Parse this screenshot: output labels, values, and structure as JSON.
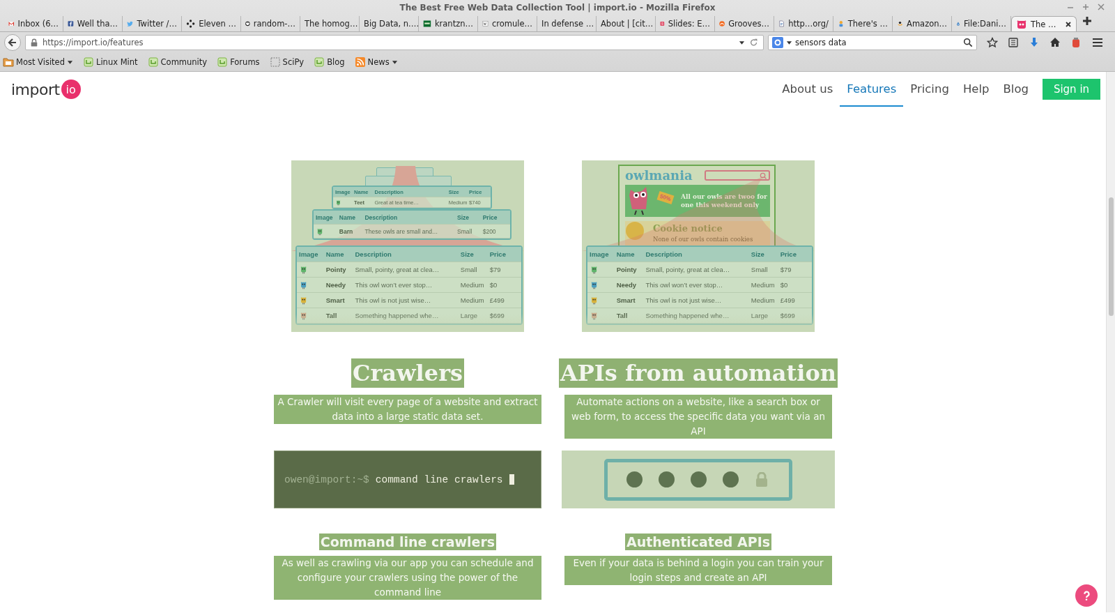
{
  "window": {
    "title": "The Best Free Web Data Collection Tool | import.io - Mozilla Firefox"
  },
  "tabs": [
    {
      "label": "Inbox (6…",
      "selected": false
    },
    {
      "label": "Well tha…",
      "selected": false
    },
    {
      "label": "Twitter /…",
      "selected": false
    },
    {
      "label": "Eleven …",
      "selected": false
    },
    {
      "label": "random-…",
      "selected": false
    },
    {
      "label": "The homog…",
      "selected": false
    },
    {
      "label": "Big Data, n.…",
      "selected": false
    },
    {
      "label": "krantzn…",
      "selected": false
    },
    {
      "label": "cromule…",
      "selected": false
    },
    {
      "label": "In defense …",
      "selected": false
    },
    {
      "label": "About | [cit…",
      "selected": false
    },
    {
      "label": "Slides: E…",
      "selected": false
    },
    {
      "label": "Grooves…",
      "selected": false
    },
    {
      "label": "http…org/",
      "selected": false
    },
    {
      "label": "There's …",
      "selected": false
    },
    {
      "label": "Amazon…",
      "selected": false
    },
    {
      "label": "File:Dani…",
      "selected": false
    },
    {
      "label": "The …",
      "selected": true
    }
  ],
  "toolbar": {
    "url": "https://import.io/features",
    "search": {
      "value": "sensors data"
    }
  },
  "bookmarks": [
    {
      "label": "Most Visited",
      "kind": "folder",
      "dropdown": true
    },
    {
      "label": "Linux Mint",
      "kind": "page",
      "dropdown": false
    },
    {
      "label": "Community",
      "kind": "page",
      "dropdown": false
    },
    {
      "label": "Forums",
      "kind": "page",
      "dropdown": false
    },
    {
      "label": "SciPy",
      "kind": "blank",
      "dropdown": false
    },
    {
      "label": "Blog",
      "kind": "page",
      "dropdown": false
    },
    {
      "label": "News",
      "kind": "feed",
      "dropdown": true
    }
  ],
  "site": {
    "logo": {
      "text": "import",
      "badge": "io"
    },
    "nav": [
      {
        "label": "About us",
        "selected": false
      },
      {
        "label": "Features",
        "selected": true
      },
      {
        "label": "Pricing",
        "selected": false
      },
      {
        "label": "Help",
        "selected": false
      },
      {
        "label": "Blog",
        "selected": false
      }
    ],
    "sign_in": "Sign in"
  },
  "features": [
    {
      "title": "Crawlers",
      "description": "A Crawler will visit every page of a website and extract data into a large static data set.",
      "illustration": {
        "kind": "stacked_tables",
        "back_table": {
          "columns": [
            "Image",
            "Name",
            "Description",
            "Size",
            "Price"
          ],
          "rows": [
            [
              "",
              "Teet",
              "Great at tea time…",
              "Medium",
              "$740"
            ]
          ]
        },
        "middle_table": {
          "columns": [
            "Image",
            "Name",
            "Description",
            "Size",
            "Price"
          ],
          "rows": [
            [
              "",
              "Barn",
              "These owls are small and…",
              "Small",
              "$200"
            ]
          ]
        },
        "table": {
          "columns": [
            "Image",
            "Name",
            "Description",
            "Size",
            "Price"
          ],
          "rows": [
            [
              "",
              "Pointy",
              "Small, pointy, great at clea…",
              "Small",
              "$79"
            ],
            [
              "",
              "Needy",
              "This owl won’t ever stop…",
              "Medium",
              "$0"
            ],
            [
              "",
              "Smart",
              "This owl is not just wise…",
              "Medium",
              "£499"
            ],
            [
              "",
              "Tall",
              "Something happened whe…",
              "Large",
              "$699"
            ]
          ]
        }
      }
    },
    {
      "title": "APIs from automation",
      "description": "Automate actions on a website, like a search box or web form, to access the specific data you want via an API",
      "illustration": {
        "kind": "owl_site",
        "logo": "owlmania",
        "banner": {
          "tag": "50%",
          "text": "All our owls are twoo for one this weekend only"
        },
        "cookie": {
          "title": "Cookie notice",
          "text": "None of our owls contain cookies"
        },
        "table": {
          "columns": [
            "Image",
            "Name",
            "Description",
            "Size",
            "Price"
          ],
          "rows": [
            [
              "",
              "Pointy",
              "Small, pointy, great at clea…",
              "Small",
              "$79"
            ],
            [
              "",
              "Needy",
              "This owl won’t ever stop…",
              "Medium",
              "$0"
            ],
            [
              "",
              "Smart",
              "This owl is not just wise…",
              "Medium",
              "£499"
            ],
            [
              "",
              "Tall",
              "Something happened whe…",
              "Large",
              "$699"
            ]
          ]
        }
      }
    }
  ],
  "extras": [
    {
      "title": "Command line crawlers",
      "description": "As well as crawling via our app you can schedule and configure your crawlers using the power of the command line",
      "demo": {
        "kind": "terminal",
        "prompt": "owen@import:~$",
        "command": "command line crawlers"
      }
    },
    {
      "title": "Authenticated APIs",
      "description": "Even if your data is behind a login you can train your login steps and create an API",
      "demo": {
        "kind": "password"
      }
    }
  ]
}
